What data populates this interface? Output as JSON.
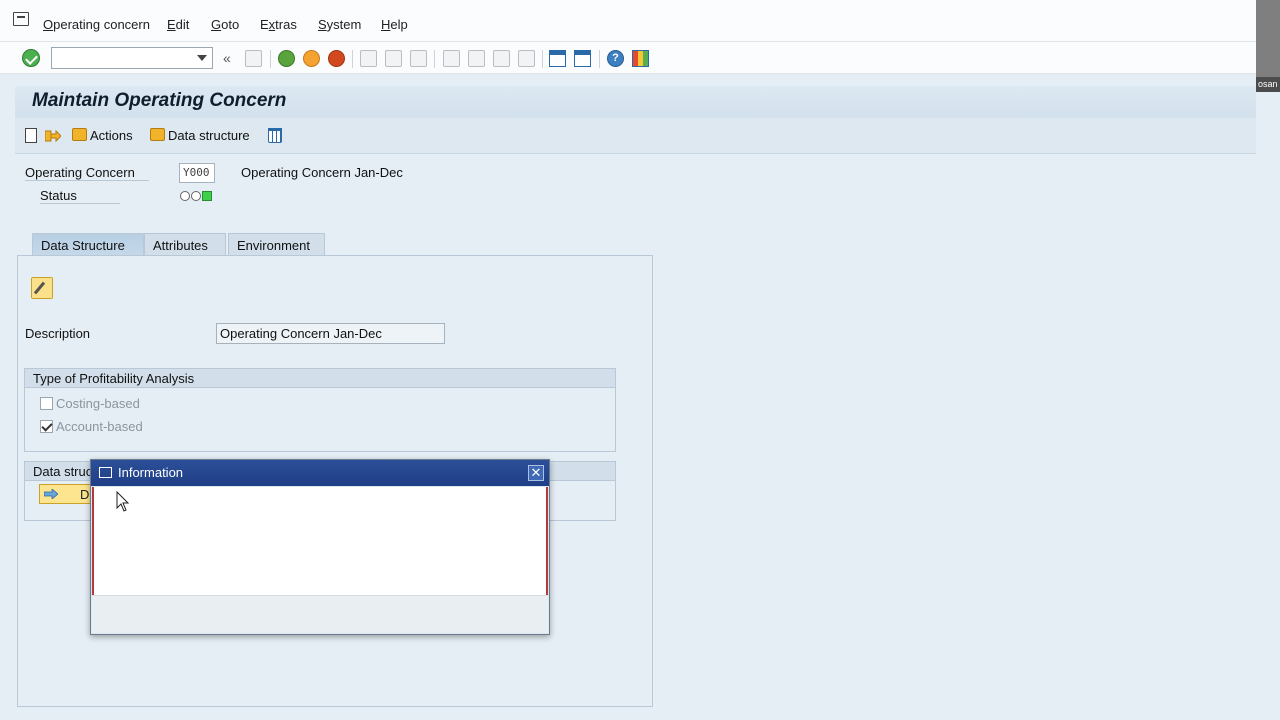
{
  "menubar": {
    "items": [
      {
        "label": "Operating concern",
        "u": "O"
      },
      {
        "label": "Edit",
        "u": "E"
      },
      {
        "label": "Goto",
        "u": "G"
      },
      {
        "label": "Extras",
        "u": "x"
      },
      {
        "label": "System",
        "u": "S"
      },
      {
        "label": "Help",
        "u": "H"
      }
    ]
  },
  "toolbar": {
    "command_field_value": ""
  },
  "page": {
    "title": "Maintain Operating Concern"
  },
  "app_toolbar": {
    "actions_label": "Actions",
    "data_structure_label": "Data structure"
  },
  "header": {
    "operating_concern_label": "Operating Concern",
    "operating_concern_value": "Y000",
    "operating_concern_text": "Operating Concern Jan-Dec",
    "status_label": "Status"
  },
  "tabs": [
    {
      "label": "Data Structure",
      "active": true
    },
    {
      "label": "Attributes",
      "active": false
    },
    {
      "label": "Environment",
      "active": false
    }
  ],
  "data_structure_tab": {
    "description_label": "Description",
    "description_value": "Operating Concern Jan-Dec",
    "type_group_title": "Type of Profitability Analysis",
    "costing_based_label": "Costing-based",
    "costing_based_checked": false,
    "account_based_label": "Account-based",
    "account_based_checked": true,
    "data_structure_group_title": "Data struc",
    "display_button_label": "Di"
  },
  "dialog": {
    "title": "Information"
  },
  "overlay": {
    "clipped_text": "osan"
  },
  "colors": {
    "background": "#e5eef5",
    "dialog_title_bar": "#1f3f86",
    "status_green": "#3fd04a",
    "ok_green": "#4caf50"
  }
}
